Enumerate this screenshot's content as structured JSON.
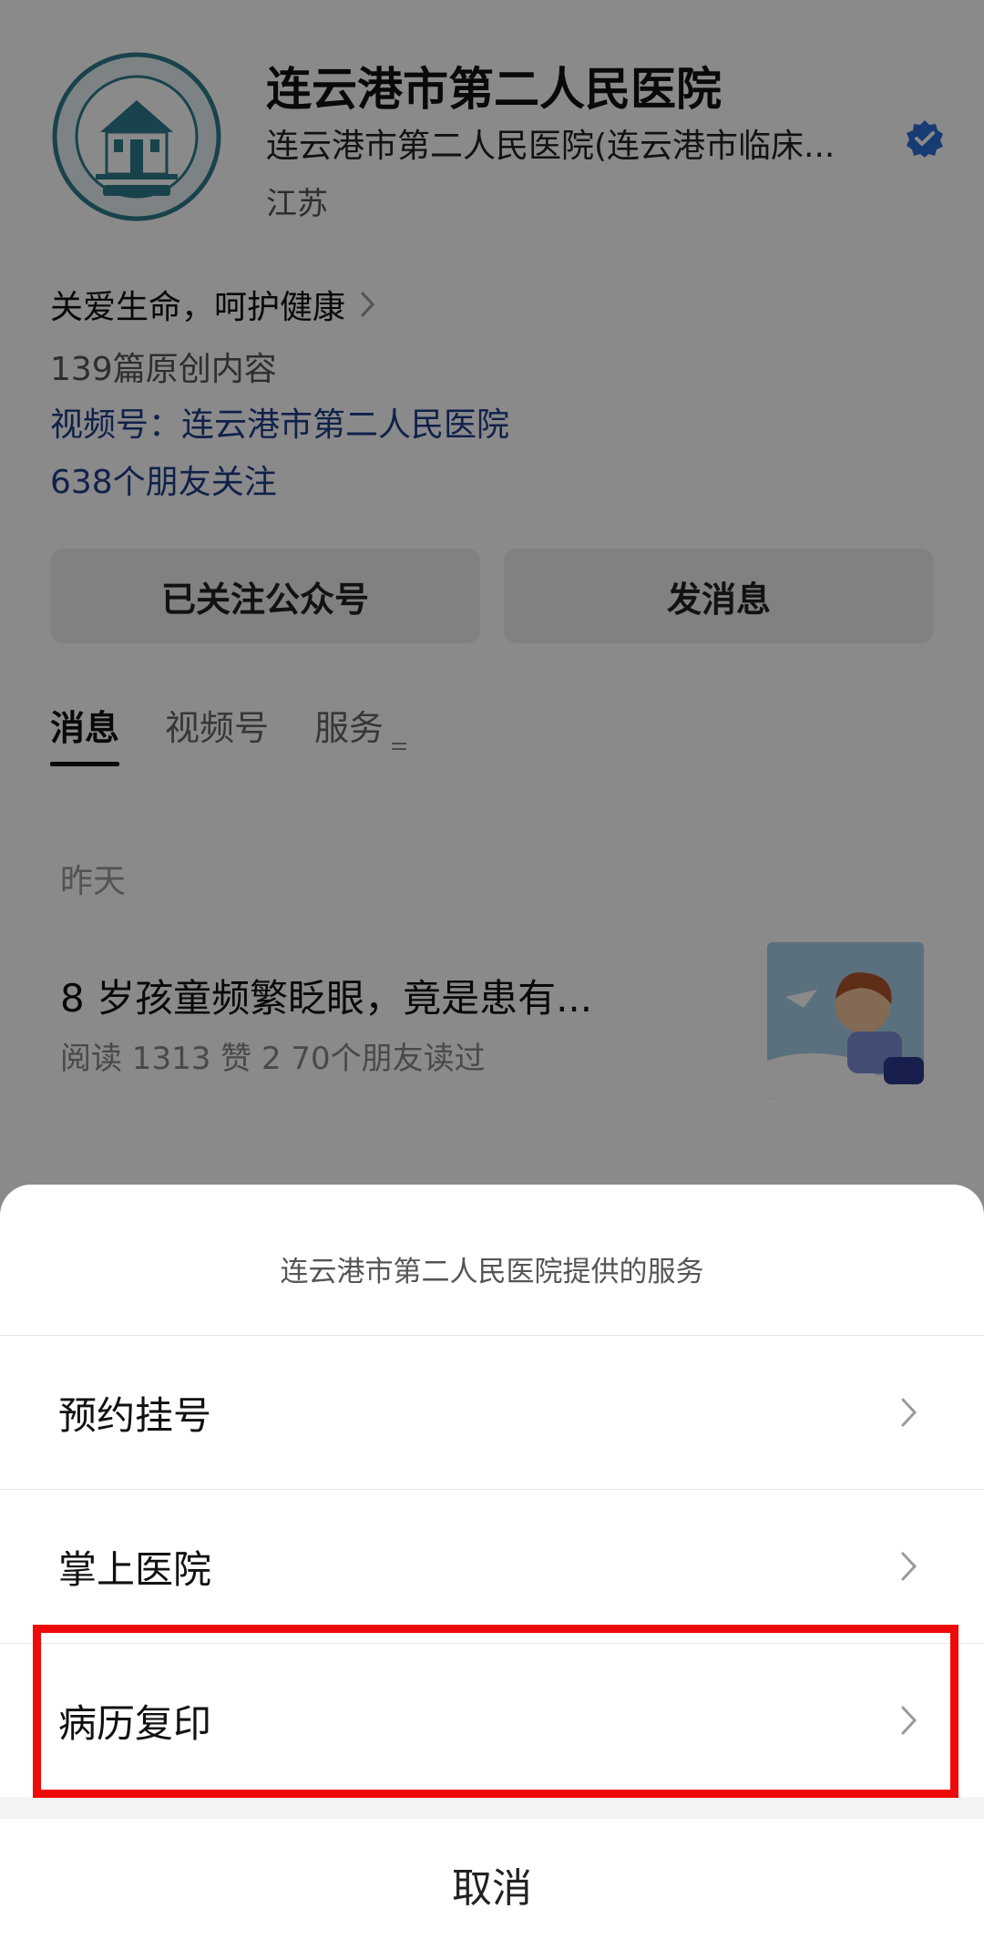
{
  "profile": {
    "name": "连云港市第二人民医院",
    "full_name": "连云港市第二人民医院(连云港市临床...",
    "region": "江苏",
    "verified_icon": "verified-check-icon",
    "logo_text": "连云港市第二人民医院",
    "logo_icon": "hospital-seal-logo"
  },
  "info": {
    "slogan": "关爱生命，呵护健康",
    "original_count": "139篇原创内容",
    "channel": "视频号：连云港市第二人民医院",
    "friends_following": "638个朋友关注"
  },
  "actions": {
    "follow_label": "已关注公众号",
    "message_label": "发消息"
  },
  "tabs": [
    {
      "label": "消息",
      "active": true
    },
    {
      "label": "视频号",
      "active": false
    },
    {
      "label": "服务",
      "active": false
    }
  ],
  "article": {
    "date": "昨天",
    "title": "8 岁孩童频繁眨眼，竟是患有...",
    "stats": "阅读 1313   赞 2   70个朋友读过"
  },
  "sheet": {
    "title": "连云港市第二人民医院提供的服务",
    "items": [
      {
        "label": "预约挂号"
      },
      {
        "label": "掌上医院"
      },
      {
        "label": "病历复印"
      }
    ],
    "cancel_label": "取消"
  },
  "colors": {
    "highlight": "#ee0a0a",
    "link": "#1e3d8a",
    "verified": "#2b6fd6",
    "logo": "#2e7c8c"
  }
}
